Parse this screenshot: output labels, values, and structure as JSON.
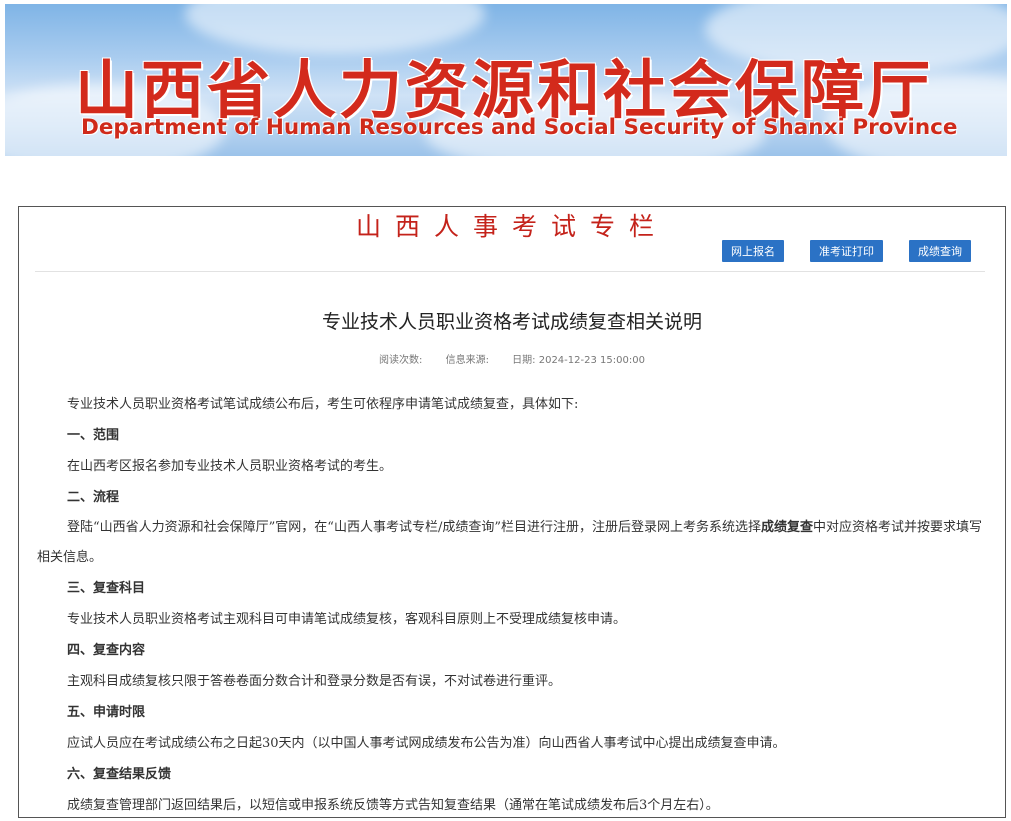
{
  "banner": {
    "title": "山西省人力资源和社会保障厅",
    "subtitle": "Department of Human Resources and Social Security of Shanxi Province"
  },
  "column": {
    "title": "山西人事考试专栏",
    "links": [
      "网上报名",
      "准考证打印",
      "成绩查询"
    ]
  },
  "article": {
    "title": "专业技术人员职业资格考试成绩复查相关说明",
    "meta": {
      "views": "阅读次数:",
      "source": "信息来源:",
      "date": "日期: 2024-12-23 15:00:00"
    },
    "intro": "专业技术人员职业资格考试笔试成绩公布后，考生可依程序申请笔试成绩复查，具体如下:",
    "s1_heading": "一、范围",
    "s1_text": "在山西考区报名参加专业技术人员职业资格考试的考生。",
    "s2_heading": "二、流程",
    "s2_text_a": "登陆“山西省人力资源和社会保障厅”官网，在“山西人事考试专栏/成绩查询”栏目进行注册，注册后登录网上考务系统选择",
    "s2_text_bold": "成绩复查",
    "s2_text_b": "中对应资格考试并按要求填写相关信息。",
    "s3_heading": "三、复查科目",
    "s3_text": "专业技术人员职业资格考试主观科目可申请笔试成绩复核，客观科目原则上不受理成绩复核申请。",
    "s4_heading": "四、复查内容",
    "s4_text": "主观科目成绩复核只限于答卷卷面分数合计和登录分数是否有误，不对试卷进行重评。",
    "s5_heading": "五、申请时限",
    "s5_text": "应试人员应在考试成绩公布之日起30天内（以中国人事考试网成绩发布公告为准）向山西省人事考试中心提出成绩复查申请。",
    "s6_heading": "六、复查结果反馈",
    "s6_text": "成绩复查管理部门返回结果后，以短信或申报系统反馈等方式告知复查结果（通常在笔试成绩发布后3个月左右）。"
  }
}
